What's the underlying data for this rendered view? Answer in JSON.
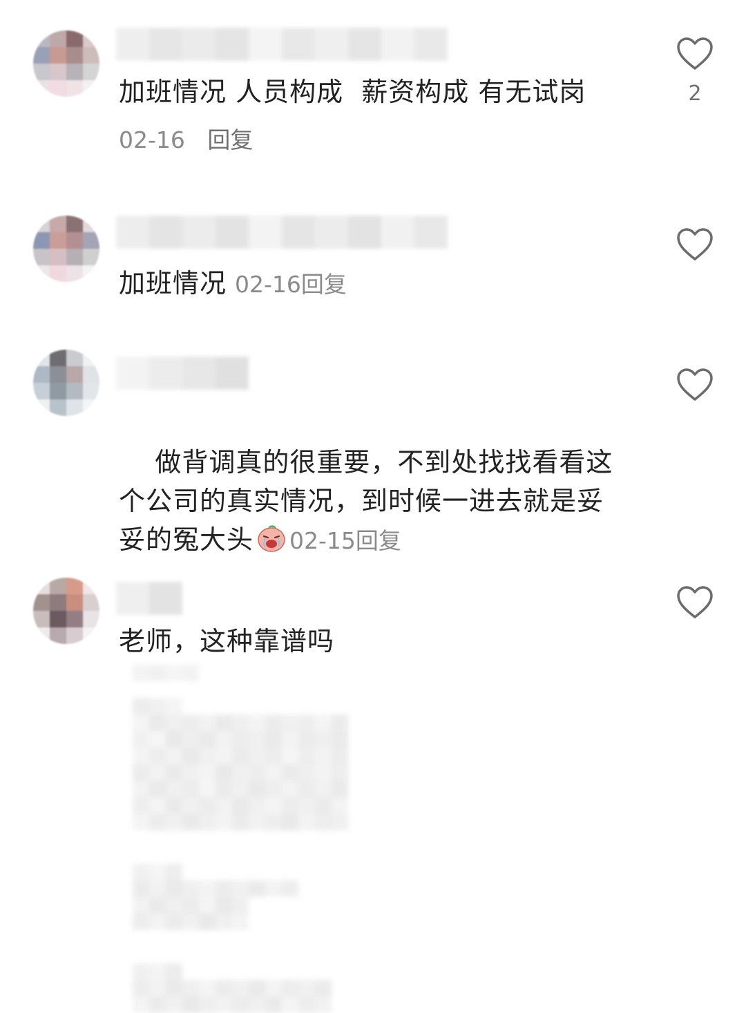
{
  "comments": [
    {
      "text": "加班情况 人员构成  薪资构成 有无试岗",
      "date": "02-16",
      "reply_label": "回复",
      "like_count": "2"
    },
    {
      "text": "加班情况",
      "date": "02-16",
      "reply_label": "回复"
    },
    {
      "text": "做背调真的很重要，不到处找找看看这个公司的真实情况，到时候一进去就是妥妥的冤大头",
      "date": "02-15",
      "reply_label": "回复",
      "emoji": "crying-face-emoji"
    },
    {
      "text": "老师，这种靠谱吗"
    }
  ],
  "icons": {
    "like": "heart-outline-icon"
  },
  "colors": {
    "text": "#222222",
    "meta": "#8a8a8a",
    "icon": "#6b6b6b"
  }
}
